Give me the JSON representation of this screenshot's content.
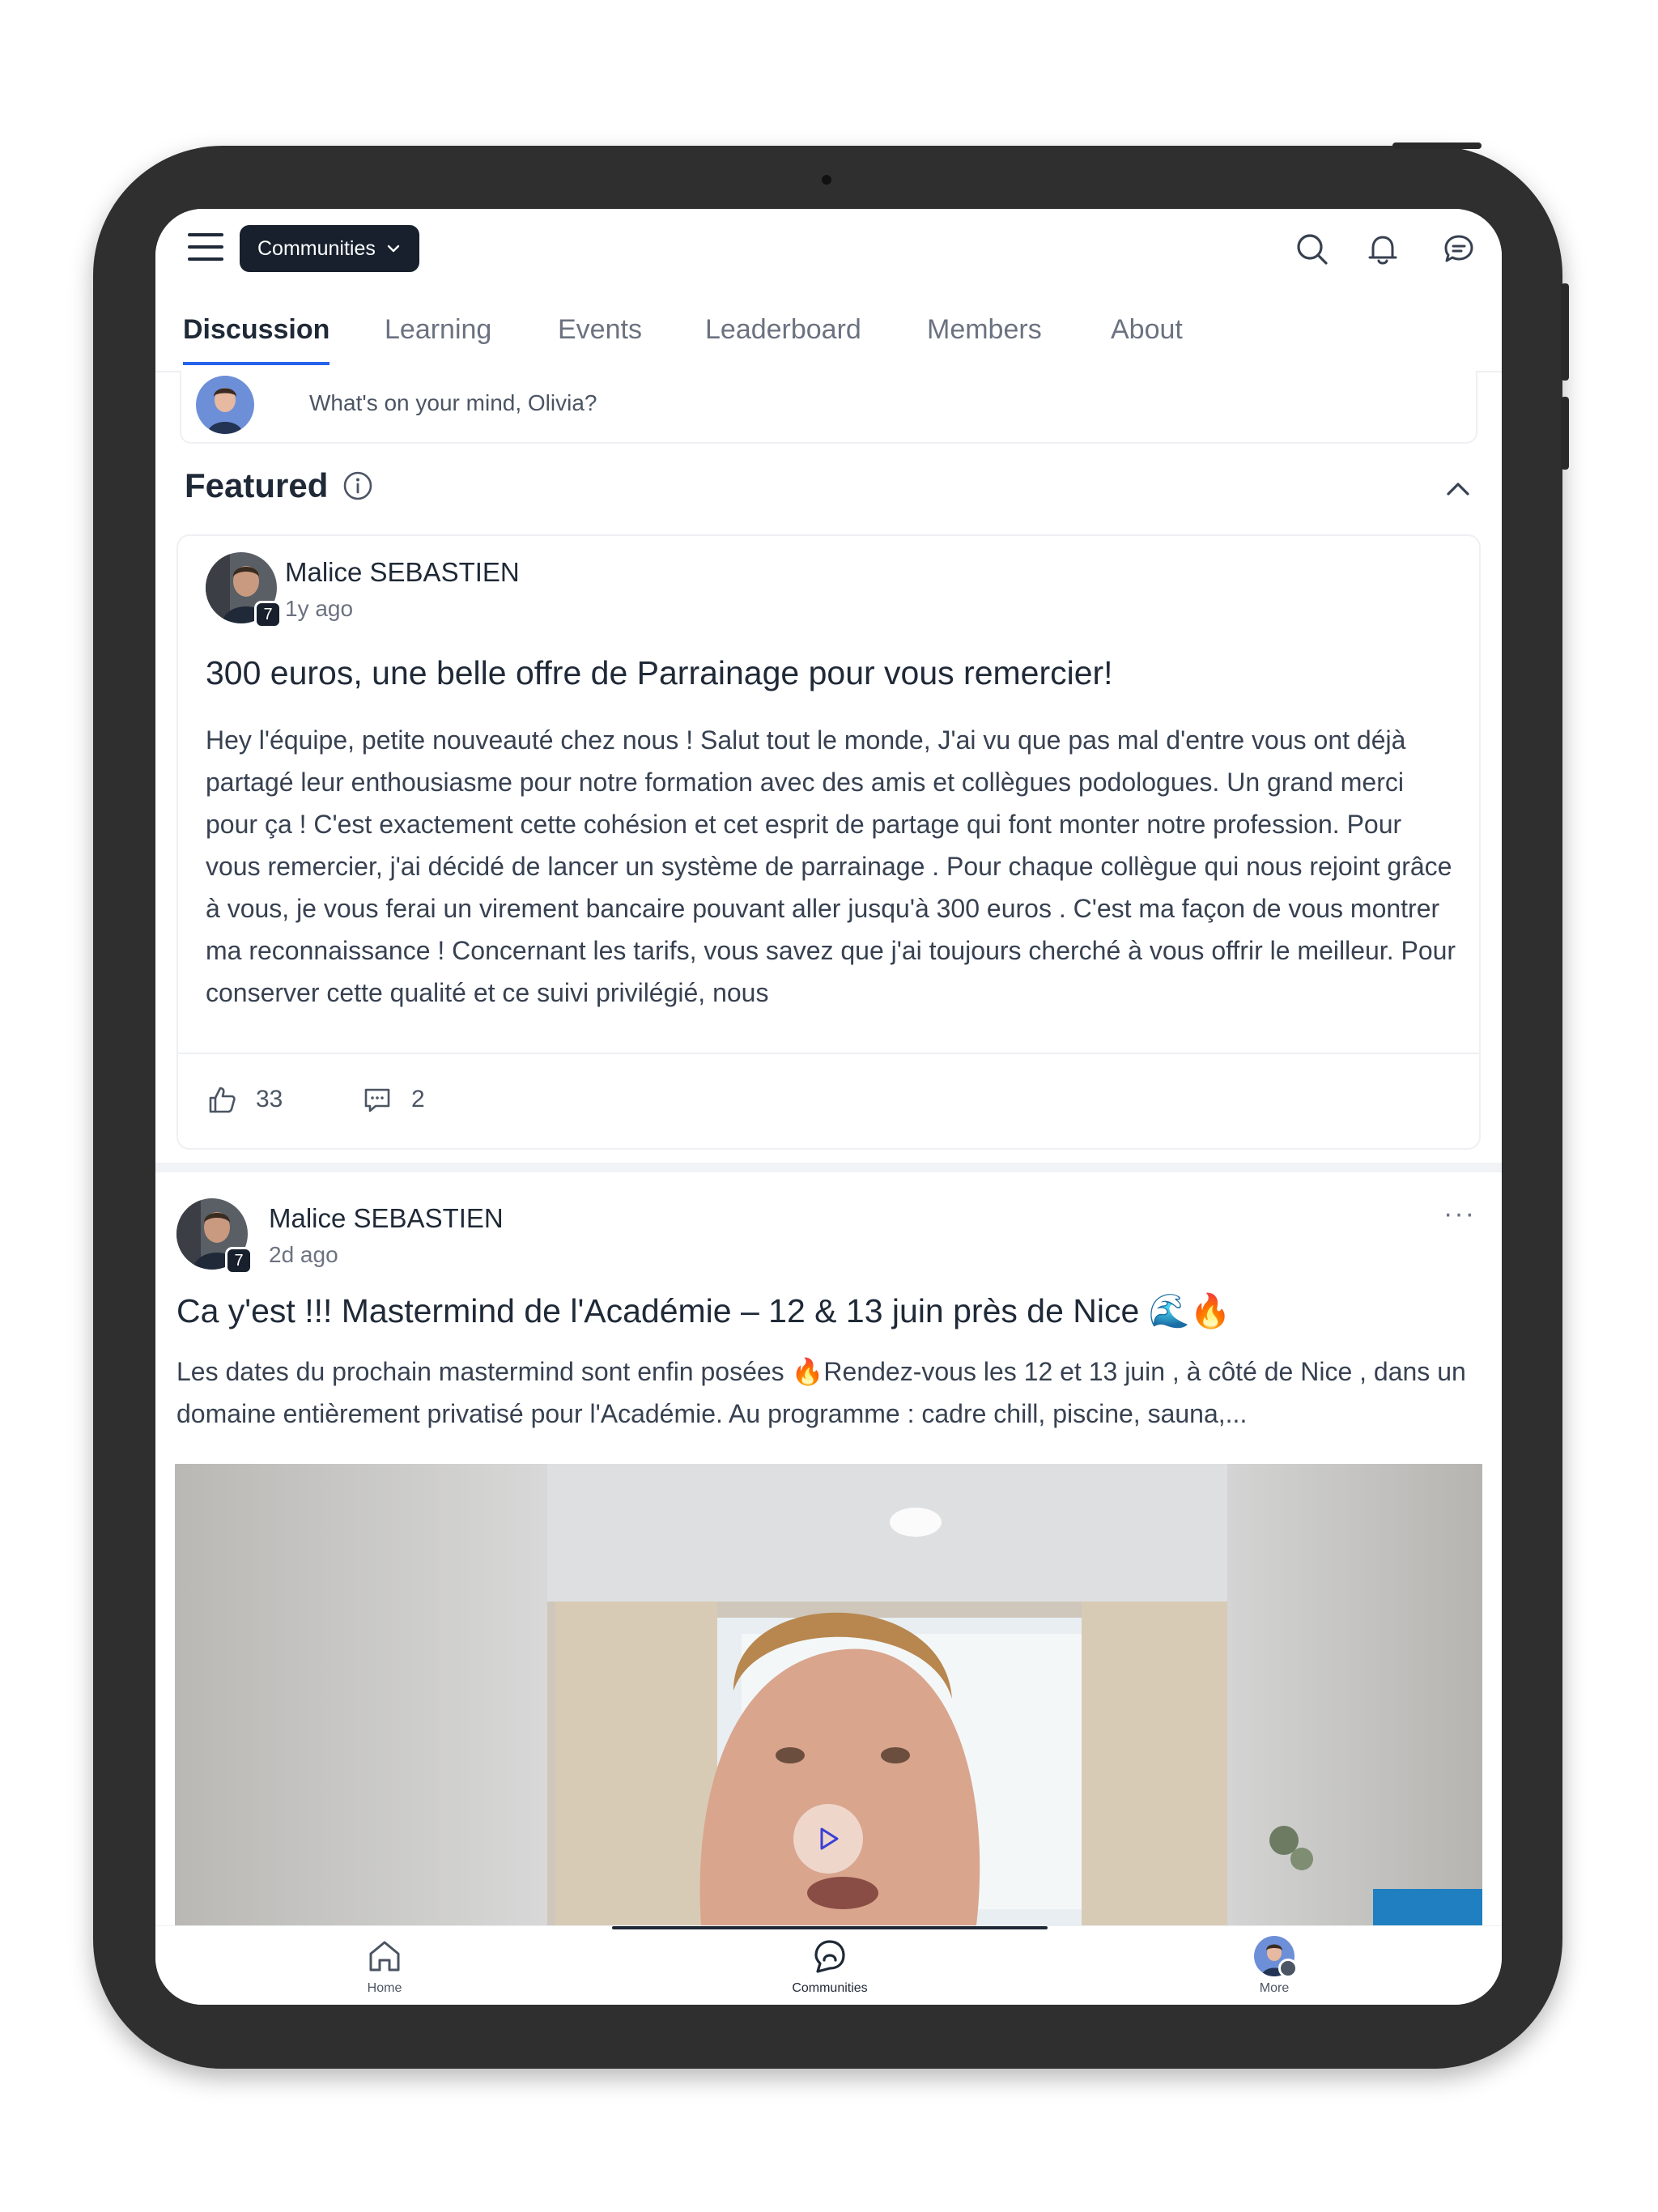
{
  "header": {
    "community_label": "Communities"
  },
  "tabs": [
    {
      "label": "Discussion",
      "active": true
    },
    {
      "label": "Learning",
      "active": false
    },
    {
      "label": "Events",
      "active": false
    },
    {
      "label": "Leaderboard",
      "active": false
    },
    {
      "label": "Members",
      "active": false
    },
    {
      "label": "About",
      "active": false
    }
  ],
  "composer": {
    "placeholder": "What's on your mind, Olivia?"
  },
  "featured": {
    "heading": "Featured",
    "post": {
      "author": "Malice SEBASTIEN",
      "level_badge": "7",
      "time": "1y ago",
      "title": "300 euros, une belle offre de Parrainage pour vous remercier!",
      "body": "Hey l'équipe, petite nouveauté chez nous ! Salut tout le monde, J'ai vu que pas mal d'entre vous ont déjà partagé leur enthousiasme pour notre formation avec des amis et collègues podologues. Un grand merci pour ça ! C'est exactement cette cohésion et cet esprit de partage qui font monter notre profession. Pour vous remercier, j'ai décidé de lancer un système de parrainage . Pour chaque collègue qui nous rejoint grâce à vous, je vous ferai un virement bancaire pouvant aller jusqu'à 300 euros . C'est ma façon de vous montrer ma reconnaissance !  Concernant les tarifs, vous savez que j'ai toujours cherché à vous offrir le meilleur. Pour conserver cette qualité et ce suivi privilégié, nous",
      "likes": "33",
      "comments": "2"
    }
  },
  "feed": {
    "post": {
      "author": "Malice SEBASTIEN",
      "level_badge": "7",
      "time": "2d ago",
      "more": "···",
      "title": "Ca y'est !!! Mastermind de l'Académie – 12 & 13 juin près de Nice 🌊🔥",
      "excerpt": "Les dates du prochain mastermind sont enfin posées 🔥Rendez-vous les 12 et 13 juin , à côté de Nice , dans un domaine entièrement privatisé pour l'Académie. Au programme : cadre chill, piscine, sauna,..."
    }
  },
  "bottom_nav": [
    {
      "label": "Home",
      "icon": "home-icon",
      "active": false
    },
    {
      "label": "Communities",
      "icon": "communities-icon",
      "active": true
    },
    {
      "label": "More",
      "icon": "avatar",
      "active": false
    }
  ],
  "colors": {
    "accent": "#2563eb",
    "pill_bg": "#17202c",
    "frame": "#2f2f30"
  }
}
